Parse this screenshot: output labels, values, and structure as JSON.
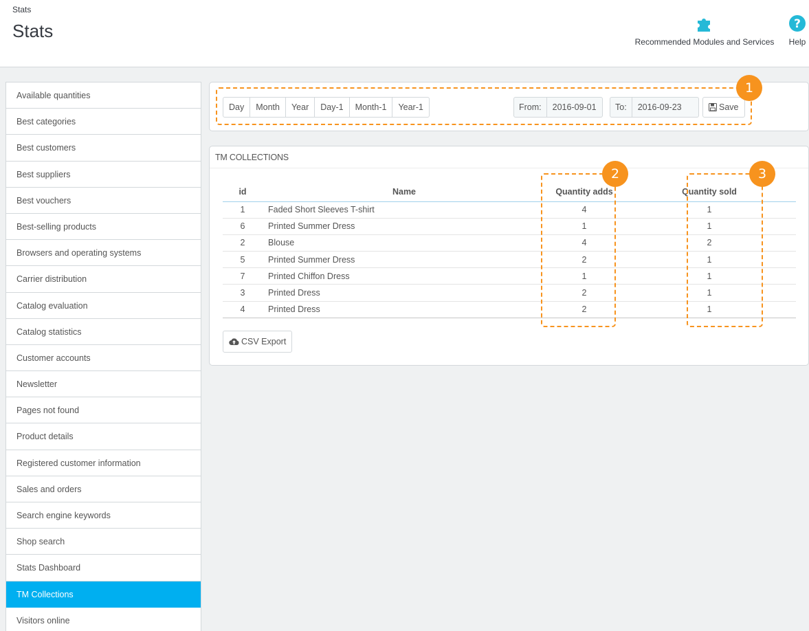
{
  "header": {
    "breadcrumb": "Stats",
    "title": "Stats",
    "modules_label": "Recommended Modules and Services",
    "help_label": "Help"
  },
  "sidebar": {
    "active_color": "#00aff0",
    "items": [
      {
        "label": "Available quantities"
      },
      {
        "label": "Best categories"
      },
      {
        "label": "Best customers"
      },
      {
        "label": "Best suppliers"
      },
      {
        "label": "Best vouchers"
      },
      {
        "label": "Best-selling products"
      },
      {
        "label": "Browsers and operating systems"
      },
      {
        "label": "Carrier distribution"
      },
      {
        "label": "Catalog evaluation"
      },
      {
        "label": "Catalog statistics"
      },
      {
        "label": "Customer accounts"
      },
      {
        "label": "Newsletter"
      },
      {
        "label": "Pages not found"
      },
      {
        "label": "Product details"
      },
      {
        "label": "Registered customer information"
      },
      {
        "label": "Sales and orders"
      },
      {
        "label": "Search engine keywords"
      },
      {
        "label": "Shop search"
      },
      {
        "label": "Stats Dashboard"
      },
      {
        "label": "TM Collections",
        "active": true
      },
      {
        "label": "Visitors online"
      }
    ]
  },
  "date_range": {
    "periods": [
      "Day",
      "Month",
      "Year",
      "Day-1",
      "Month-1",
      "Year-1"
    ],
    "from_label": "From:",
    "from_value": "2016-09-01",
    "to_label": "To:",
    "to_value": "2016-09-23",
    "save_label": "Save"
  },
  "collections": {
    "heading": "TM COLLECTIONS",
    "columns": {
      "id": "id",
      "name": "Name",
      "quantity_adds": "Quantity adds",
      "quantity_sold": "Quantity sold"
    },
    "rows": [
      {
        "id": "1",
        "name": "Faded Short Sleeves T-shirt",
        "quantity_adds": "4",
        "quantity_sold": "1"
      },
      {
        "id": "6",
        "name": "Printed Summer Dress",
        "quantity_adds": "1",
        "quantity_sold": "1"
      },
      {
        "id": "2",
        "name": "Blouse",
        "quantity_adds": "4",
        "quantity_sold": "2"
      },
      {
        "id": "5",
        "name": "Printed Summer Dress",
        "quantity_adds": "2",
        "quantity_sold": "1"
      },
      {
        "id": "7",
        "name": "Printed Chiffon Dress",
        "quantity_adds": "1",
        "quantity_sold": "1"
      },
      {
        "id": "3",
        "name": "Printed Dress",
        "quantity_adds": "2",
        "quantity_sold": "1"
      },
      {
        "id": "4",
        "name": "Printed Dress",
        "quantity_adds": "2",
        "quantity_sold": "1"
      }
    ],
    "csv_export_label": "CSV Export"
  },
  "annotations": {
    "color": "#f7931e",
    "badges": [
      "1",
      "2",
      "3"
    ]
  },
  "icons": {
    "modules": "puzzle-icon",
    "help": "question-circle-icon",
    "save": "floppy-disk-icon",
    "csv": "cloud-upload-icon"
  }
}
